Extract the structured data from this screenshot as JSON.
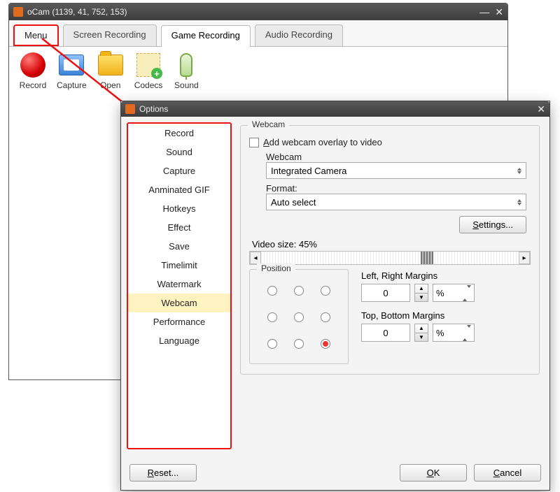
{
  "main": {
    "title": "oCam (1139, 41, 752, 153)",
    "tabs": {
      "menu": "Menu",
      "screen": "Screen Recording",
      "game": "Game Recording",
      "audio": "Audio Recording"
    },
    "tools": {
      "record": "Record",
      "capture": "Capture",
      "open": "Open",
      "codecs": "Codecs",
      "sound": "Sound"
    }
  },
  "options": {
    "title": "Options",
    "sidebar": [
      "Record",
      "Sound",
      "Capture",
      "Anminated GIF",
      "Hotkeys",
      "Effect",
      "Save",
      "Timelimit",
      "Watermark",
      "Webcam",
      "Performance",
      "Language"
    ],
    "selected_index": 9,
    "webcam_group": "Webcam",
    "add_overlay": "Add webcam overlay to video",
    "webcam_label": "Webcam",
    "webcam_value": "Integrated Camera",
    "format_label": "Format:",
    "format_value": "Auto select",
    "settings_btn": "Settings...",
    "video_size_label": "Video size: 45%",
    "position_group": "Position",
    "left_right": "Left, Right Margins",
    "top_bottom": "Top, Bottom Margins",
    "margin_lr_value": "0",
    "margin_tb_value": "0",
    "unit": "%",
    "reset": "Reset...",
    "ok": "OK",
    "cancel": "Cancel"
  }
}
